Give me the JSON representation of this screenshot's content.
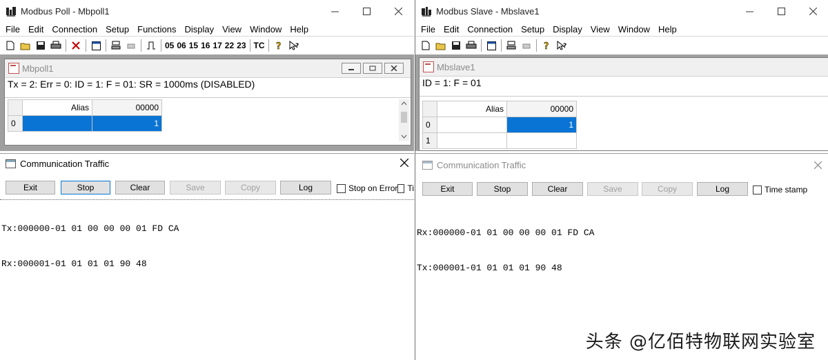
{
  "poll": {
    "title": "Modbus Poll - Mbpoll1",
    "menu": [
      "File",
      "Edit",
      "Connection",
      "Setup",
      "Functions",
      "Display",
      "View",
      "Window",
      "Help"
    ],
    "function_codes": [
      "05",
      "06",
      "15",
      "16",
      "17",
      "22",
      "23"
    ],
    "tc_label": "TC",
    "child": {
      "title": "Mbpoll1",
      "status": "Tx = 2: Err = 0: ID = 1: F = 01: SR = 1000ms  (DISABLED)",
      "col_alias": "Alias",
      "col_addr": "00000",
      "rows": [
        {
          "index": "0",
          "alias": "",
          "value": "1"
        }
      ]
    },
    "traffic": {
      "title": "Communication Traffic",
      "buttons": [
        "Exit",
        "Stop",
        "Clear",
        "Save",
        "Copy",
        "Log"
      ],
      "checkboxes": [
        "Stop on Error",
        "Ti"
      ],
      "lines": [
        "Tx:000000-01 01 00 00 00 01 FD CA",
        "Rx:000001-01 01 01 01 90 48"
      ]
    }
  },
  "slave": {
    "title": "Modbus Slave - Mbslave1",
    "menu": [
      "File",
      "Edit",
      "Connection",
      "Setup",
      "Display",
      "View",
      "Window",
      "Help"
    ],
    "child": {
      "title": "Mbslave1",
      "status": "ID = 1: F = 01",
      "col_alias": "Alias",
      "col_addr": "00000",
      "rows": [
        {
          "index": "0",
          "alias": "",
          "value": "1"
        },
        {
          "index": "1",
          "alias": "",
          "value": ""
        }
      ]
    },
    "traffic": {
      "title": "Communication Traffic",
      "buttons": [
        "Exit",
        "Stop",
        "Clear",
        "Save",
        "Copy",
        "Log"
      ],
      "checkboxes": [
        "Time stamp"
      ],
      "lines": [
        "Rx:000000-01 01 00 00 00 01 FD CA",
        "Tx:000001-01 01 01 01 90 48"
      ]
    }
  },
  "watermark": "头条 @亿佰特物联网实验室",
  "colors": {
    "selection": "#0a74d4",
    "mdi_background": "#a0a0a0"
  }
}
